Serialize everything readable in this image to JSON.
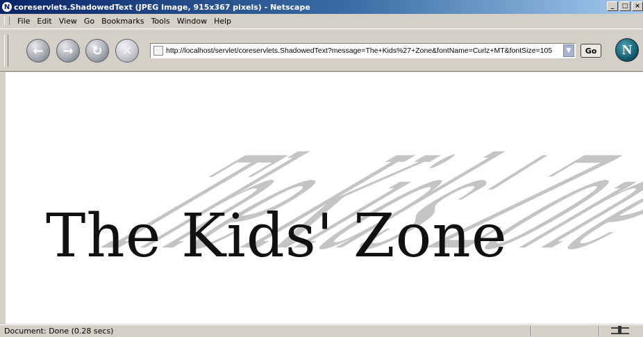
{
  "window": {
    "title": "coreservlets.ShadowedText (JPEG Image, 915x367 pixels) - Netscape",
    "app_icon": "N",
    "buttons": {
      "minimize": "_",
      "maximize": "□",
      "close": "×"
    }
  },
  "menu": {
    "items": [
      "File",
      "Edit",
      "View",
      "Go",
      "Bookmarks",
      "Tools",
      "Window",
      "Help"
    ]
  },
  "toolbar": {
    "back_icon": "arrow-left-icon",
    "forward_icon": "arrow-right-icon",
    "reload_icon": "reload-icon",
    "stop_icon": "stop-icon",
    "back_glyph": "←",
    "forward_glyph": "→",
    "reload_glyph": "↻",
    "stop_glyph": "✕",
    "url": "http://localhost/servlet/coreservlets.ShadowedText?message=The+Kids%27+Zone&fontName=Curlz+MT&fontSize=105",
    "dropdown_glyph": "▼",
    "go_label": "Go",
    "throbber_glyph": "N"
  },
  "content": {
    "message": "The Kids' Zone",
    "shadow_color": "#c4c4c4",
    "text_color": "#111111"
  },
  "status": {
    "text": "Document: Done (0.28 secs)"
  },
  "colors": {
    "titlebar_start": "#0a246a",
    "titlebar_end": "#a6caf0",
    "chrome": "#d4d0c8"
  }
}
